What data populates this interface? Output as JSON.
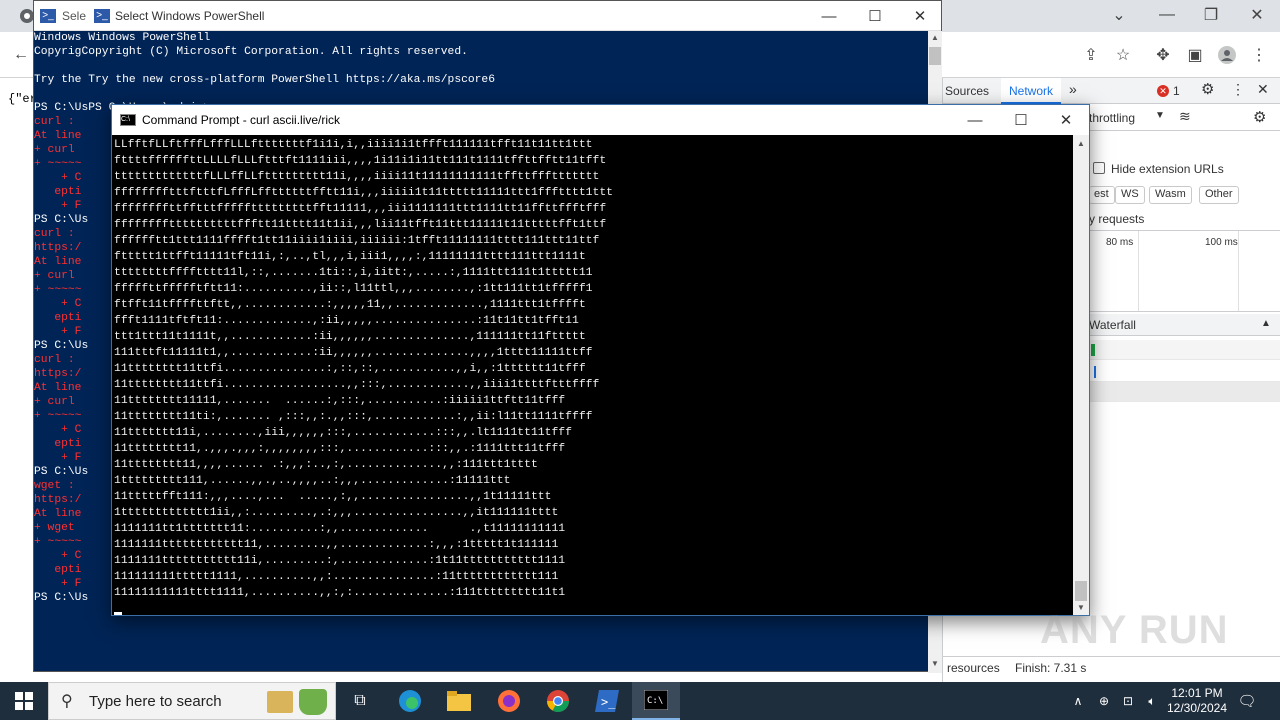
{
  "browser": {
    "left_text": "{\"er",
    "devtools": {
      "tab_sources": "Sources",
      "tab_network": "Network",
      "error_count": "1",
      "throttling": "throttling",
      "hide_extension_urls": "Hide extension URLs",
      "filter_chips": [
        "est",
        "WS",
        "Wasm",
        "Other"
      ],
      "requests_label": "y requests",
      "timeline_ticks": [
        "80 ms",
        "100 ms"
      ],
      "waterfall_label": "Waterfall",
      "status_resources": "resources",
      "status_finish": "Finish: 7.31 s",
      "colors": {
        "accent": "#1a73e8",
        "error": "#d93025"
      }
    }
  },
  "powershell": {
    "tab_fragment": "Sele",
    "title": "Select Windows PowerShell",
    "lines": [
      {
        "text": "Windows Windows PowerShell",
        "color": "#ffffff"
      },
      {
        "text": "CopyrigCopyright (C) Microsoft Corporation. All rights reserved.",
        "color": "#ffffff"
      },
      {
        "text": "",
        "color": "#ffffff"
      },
      {
        "text": "Try the Try the new cross-platform PowerShell https://aka.ms/pscore6",
        "color": "#ffffff"
      },
      {
        "text": "",
        "color": "#ffffff"
      },
      {
        "text": "PS C:\\UsPS C:\\Users\\admin>",
        "color": "#ffffff"
      },
      {
        "text": "curl : ",
        "color": "#ff3030"
      },
      {
        "text": "At line",
        "color": "#ff3030"
      },
      {
        "text": "+ curl ",
        "color": "#ff3030"
      },
      {
        "text": "+ ~~~~~",
        "color": "#ff3030"
      },
      {
        "text": "    + C",
        "color": "#ff3030"
      },
      {
        "text": "   epti",
        "color": "#ff3030"
      },
      {
        "text": "    + F",
        "color": "#ff3030"
      },
      {
        "text": "PS C:\\Us",
        "color": "#ffffff"
      },
      {
        "text": "curl : ",
        "color": "#ff3030"
      },
      {
        "text": "https:/",
        "color": "#ff3030"
      },
      {
        "text": "At line",
        "color": "#ff3030"
      },
      {
        "text": "+ curl ",
        "color": "#ff3030"
      },
      {
        "text": "+ ~~~~~",
        "color": "#ff3030"
      },
      {
        "text": "    + C",
        "color": "#ff3030"
      },
      {
        "text": "   epti",
        "color": "#ff3030"
      },
      {
        "text": "    + F",
        "color": "#ff3030"
      },
      {
        "text": "PS C:\\Us",
        "color": "#ffffff"
      },
      {
        "text": "curl : ",
        "color": "#ff3030"
      },
      {
        "text": "https:/",
        "color": "#ff3030"
      },
      {
        "text": "At line",
        "color": "#ff3030"
      },
      {
        "text": "+ curl ",
        "color": "#ff3030"
      },
      {
        "text": "+ ~~~~~",
        "color": "#ff3030"
      },
      {
        "text": "    + C",
        "color": "#ff3030"
      },
      {
        "text": "   epti",
        "color": "#ff3030"
      },
      {
        "text": "    + F",
        "color": "#ff3030"
      },
      {
        "text": "PS C:\\Us",
        "color": "#ffffff"
      },
      {
        "text": "wget : ",
        "color": "#ff3030"
      },
      {
        "text": "https:/",
        "color": "#ff3030"
      },
      {
        "text": "At line",
        "color": "#ff3030"
      },
      {
        "text": "+ wget ",
        "color": "#ff3030"
      },
      {
        "text": "+ ~~~~~",
        "color": "#ff3030"
      },
      {
        "text": "    + C",
        "color": "#ff3030"
      },
      {
        "text": "   epti",
        "color": "#ff3030"
      },
      {
        "text": "    + F",
        "color": "#ff3030"
      },
      {
        "text": "PS C:\\Us",
        "color": "#ffffff"
      }
    ]
  },
  "cmd": {
    "title": "Command Prompt - curl  ascii.live/rick",
    "lines": [
      "LLfftfLLftfffLfffLLLftttttttf1i1i,i,,iiii1i1tffft111111tfft11t11tt1ttt",
      "fttttffffffttLLLLfLLLftttft1111iii,,,,1i11i1i11tt111t1111tffttfftt11tfft",
      "tttttttttttttfLLLffLLfttttttttt11i,,,,iiii11t11111111111tffttfffttttttt",
      "fffffffftttftttfLfffLffttttttfftt11i,,,iiiii1t11ttttt11111ttt1ffftttt1ttt",
      "ffffffffttfftttffffftttttttttfft11111,,,iii1111111ttt1111tt11ffttffftfff",
      "ffffffffttttttttttffftt11tttt11t1ii,,,lii11tfft11ttt11111t11tttttfft1ttf",
      "fffffftt1ttt1111fffft1tt11iiii1iiii,iiiiii:1tfft11111111tttt111ttt11ttf",
      "fttttt1ttfft11111tft11i,:,..,tl,,,i,iii1,,,,:,11111111tttt111ttt1111t",
      "ttttttttfffftttt11l,::,.......1ti::,i,iitt:,.....:,1111ttt111t1ttttt11",
      "fffffttffffftftt11:..........,ii::,l11ttl,,,........,:1tt111tt1tfffff1",
      "ftfft11tffffttftt,,............:,,,,,11,,.............,1111ttt1tfffft",
      "ffft1111tftft11:.............,:ii,,,,,...............:11t11tt1tfft11",
      "ttt1ttt11t1111t,,............:ii,,,,,,..............,111111tt11fttttt",
      "111tttft11111t1,,............:ii,,,,,,..............,,,,1tttt11111ttff",
      "11tttttttt11ttfi...............:,::,::,...........,,i,,:1tttttt11tfff",
      "11tttttttt11ttfi..................,,:::,............,,iiii1ttttftttffff",
      "11tttttttt11111,.......  ......:,:::,...........:iiiii1ttftt11tfff",
      "11tttttttt11ti:,....... ,:::,,:.,,:::,............:,,ii:l11tt1111tffff",
      "11ttttttt11i,........,iii,,,,,,:::,............:::,,.lt1111tt11tfff",
      "11tttttttt11,.,,,.,,,:,,,,,,,,:::,............:::,,.:1111ttt11tfff",
      "11tttttttt11,,,,...... .:,,,:..,:,..............,,:111ttt1tttt",
      "1ttttttttt111,......,,.,..,,,,..:,,,.............:11111ttt",
      "11tttttfft111:,,,....,...  .....,:,,................,,1t11111ttt",
      "1ttttttttttttt1ii,,:.........,.:,,,................,,it111111tttt",
      "1111111tt1ttttttt11:..........:,,.............      .,t11111111111",
      "1111111tttttttttttt11,.........,,.............:,,,:1ttttt1t111111",
      "1111111ttttttttttt11i,.........:,.............:1t11ttttttttttt1111",
      "111111111ttttt1111,..........,,:...............:11tttttttttttt111",
      "11111111111tttt1111,..........,,:,:..............:111ttttttttt11t1"
    ]
  },
  "taskbar": {
    "search_placeholder": "Type here to search",
    "time": "12:01 PM",
    "date": "12/30/2024",
    "watermark": "ANY RUN"
  }
}
